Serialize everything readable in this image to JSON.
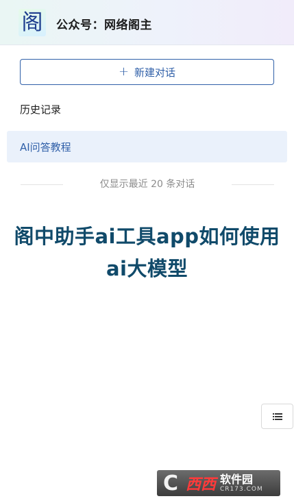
{
  "header": {
    "logo_char": "阁",
    "title": "公众号：网络阁主"
  },
  "sidebar": {
    "new_chat_label": "新建对话",
    "history_heading": "历史记录",
    "history_items": [
      {
        "label": "AI问答教程"
      }
    ],
    "limit_note": "仅显示最近 20 条对话"
  },
  "main": {
    "headline_line1": "阁中助手ai工具app如何使用",
    "headline_line2": "ai大模型"
  },
  "watermark": {
    "logo_letter": "C",
    "brand": "西西",
    "name": "软件园",
    "url": "CR173.COM"
  },
  "colors": {
    "accent": "#2f5fa8",
    "headline": "#104a6a",
    "active_item_bg": "#eaf1fb"
  },
  "icons": {
    "new_chat": "plus-icon",
    "menu": "list-menu-icon"
  }
}
